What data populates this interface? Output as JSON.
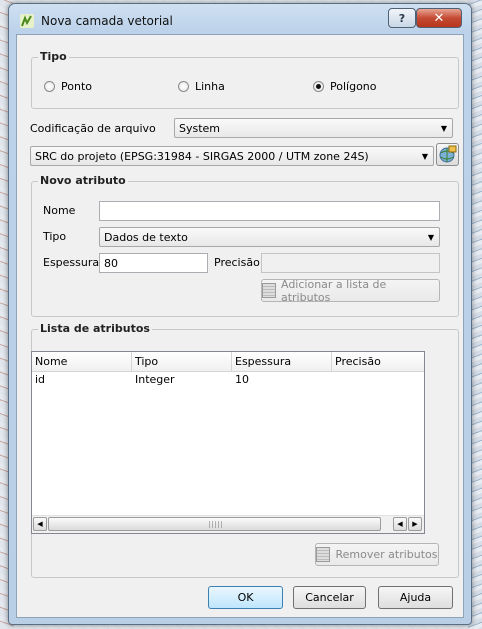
{
  "window": {
    "title": "Nova camada vetorial",
    "help_label": "?",
    "close_label": "✕"
  },
  "tipo_group": {
    "title": "Tipo",
    "options": [
      {
        "label": "Ponto",
        "checked": false
      },
      {
        "label": "Linha",
        "checked": false
      },
      {
        "label": "Polígono",
        "checked": true
      }
    ]
  },
  "encoding": {
    "label": "Codificação de arquivo",
    "value": "System"
  },
  "crs": {
    "value": "SRC do projeto (EPSG:31984 - SIRGAS 2000 / UTM zone 24S)"
  },
  "new_attribute": {
    "title": "Novo atributo",
    "name_label": "Nome",
    "name_value": "",
    "type_label": "Tipo",
    "type_value": "Dados de texto",
    "width_label": "Espessura",
    "width_value": "80",
    "precision_label": "Precisão",
    "precision_value": "",
    "add_button": "Adicionar a lista de atributos"
  },
  "attribute_list": {
    "title": "Lista de atributos",
    "columns": [
      "Nome",
      "Tipo",
      "Espessura",
      "Precisão"
    ],
    "rows": [
      {
        "nome": "id",
        "tipo": "Integer",
        "espessura": "10",
        "precisao": ""
      }
    ],
    "remove_button": "Remover atributos"
  },
  "footer": {
    "ok": "OK",
    "cancel": "Cancelar",
    "help": "Ajuda"
  }
}
